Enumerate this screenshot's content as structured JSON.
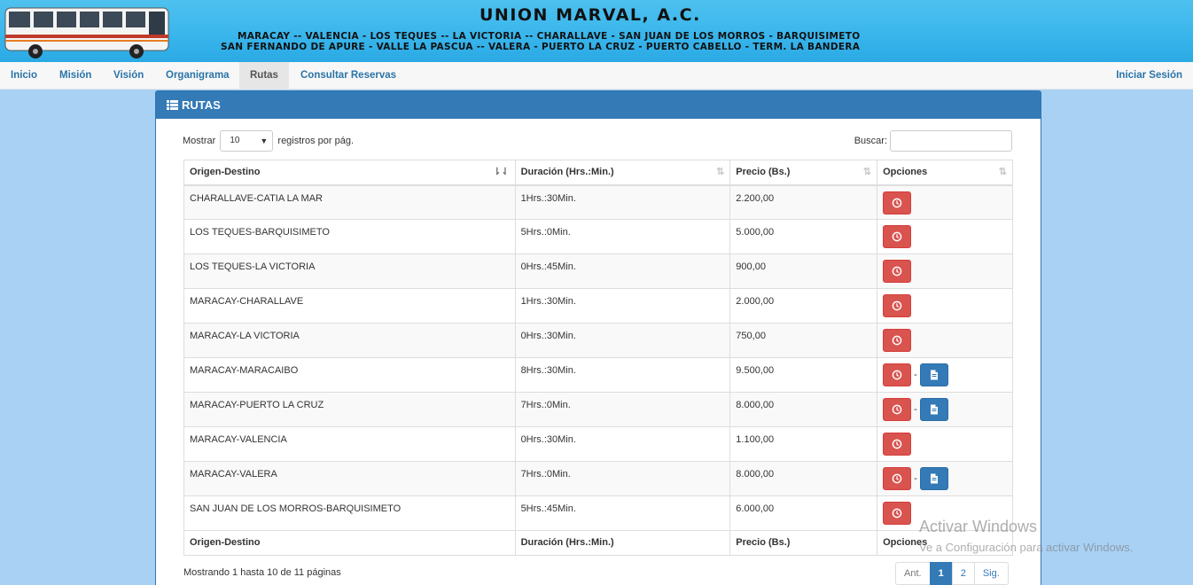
{
  "banner": {
    "title": "UNION MARVAL, A.C.",
    "line1": "MARACAY -- VALENCIA - LOS TEQUES -- LA VICTORIA -- CHARALLAVE - SAN JUAN DE LOS MORROS - BARQUISIMETO",
    "line2": "SAN FERNANDO DE APURE - VALLE LA PASCUA -- VALERA - PUERTO LA CRUZ - PUERTO CABELLO - TERM. LA BANDERA"
  },
  "nav": {
    "items": [
      "Inicio",
      "Misión",
      "Visión",
      "Organigrama",
      "Rutas",
      "Consultar Reservas"
    ],
    "active": "Rutas",
    "login": "Iniciar Sesión"
  },
  "panel": {
    "title": "RUTAS"
  },
  "controls": {
    "show_prefix": "Mostrar",
    "page_size": "10",
    "show_suffix": "registros por pág.",
    "search_label": "Buscar:",
    "search_value": ""
  },
  "table": {
    "headers": [
      "Origen-Destino",
      "Duración (Hrs.:Min.)",
      "Precio (Bs.)",
      "Opciones"
    ],
    "rows": [
      {
        "route": "CHARALLAVE-CATIA LA MAR",
        "duration": "1Hrs.:30Min.",
        "price": "2.200,00",
        "doc": false
      },
      {
        "route": "LOS TEQUES-BARQUISIMETO",
        "duration": "5Hrs.:0Min.",
        "price": "5.000,00",
        "doc": false
      },
      {
        "route": "LOS TEQUES-LA VICTORIA",
        "duration": "0Hrs.:45Min.",
        "price": "900,00",
        "doc": false
      },
      {
        "route": "MARACAY-CHARALLAVE",
        "duration": "1Hrs.:30Min.",
        "price": "2.000,00",
        "doc": false
      },
      {
        "route": "MARACAY-LA VICTORIA",
        "duration": "0Hrs.:30Min.",
        "price": "750,00",
        "doc": false
      },
      {
        "route": "MARACAY-MARACAIBO",
        "duration": "8Hrs.:30Min.",
        "price": "9.500,00",
        "doc": true
      },
      {
        "route": "MARACAY-PUERTO LA CRUZ",
        "duration": "7Hrs.:0Min.",
        "price": "8.000,00",
        "doc": true
      },
      {
        "route": "MARACAY-VALENCIA",
        "duration": "0Hrs.:30Min.",
        "price": "1.100,00",
        "doc": false
      },
      {
        "route": "MARACAY-VALERA",
        "duration": "7Hrs.:0Min.",
        "price": "8.000,00",
        "doc": true
      },
      {
        "route": "SAN JUAN DE LOS MORROS-BARQUISIMETO",
        "duration": "5Hrs.:45Min.",
        "price": "6.000,00",
        "doc": false
      }
    ],
    "separator": "-"
  },
  "footer": {
    "info": "Mostrando 1 hasta 10 de 11 páginas",
    "pager": [
      "Ant.",
      "1",
      "2",
      "Sig."
    ],
    "active_page": "1"
  },
  "watermark": {
    "line1": "Activar Windows",
    "line2": "Ve a Configuración para activar Windows."
  },
  "colors": {
    "banner": "#3ab6ec",
    "panel_heading": "#337ab7",
    "danger_button": "#d9534f",
    "primary_button": "#337ab7",
    "background": "#a9d1f4"
  }
}
